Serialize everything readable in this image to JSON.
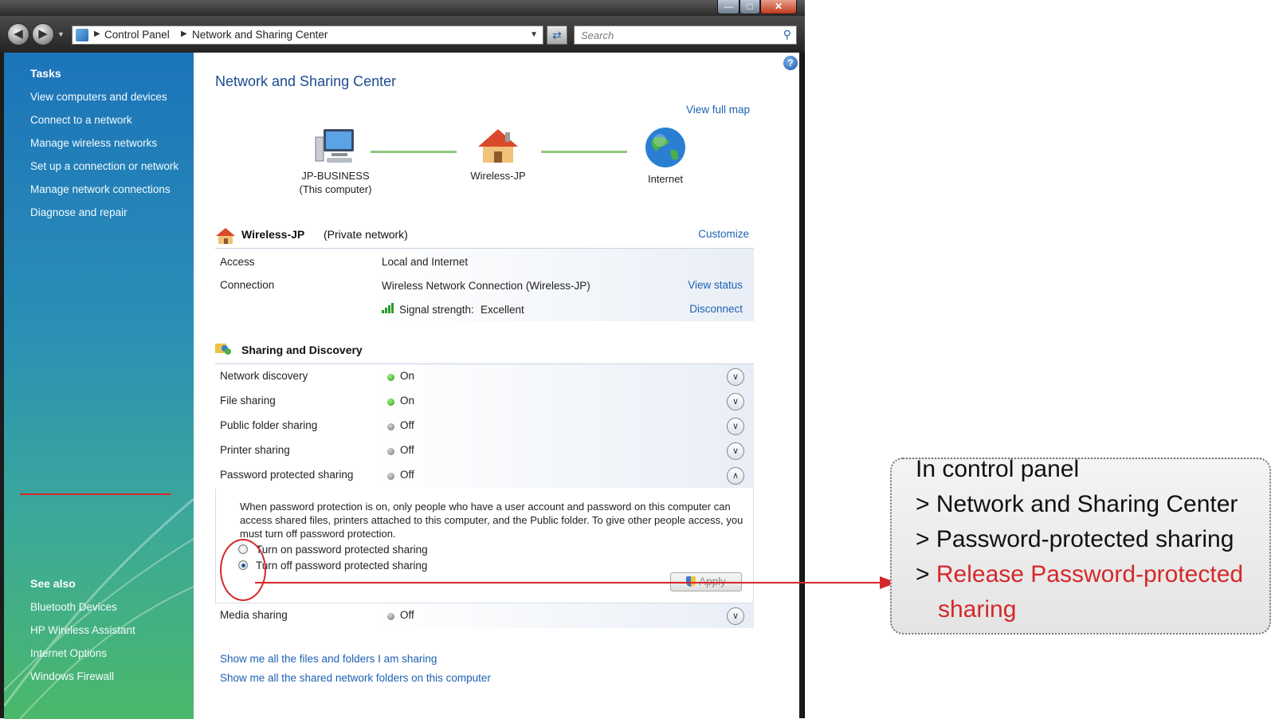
{
  "window": {
    "controls": {
      "minimize": "—",
      "maximize": "□",
      "close": "✕"
    }
  },
  "address_bar": {
    "breadcrumbs": [
      "Control Panel",
      "Network and Sharing Center"
    ],
    "search_placeholder": "Search"
  },
  "sidebar": {
    "tasks_heading": "Tasks",
    "tasks": [
      "View computers and devices",
      "Connect to a network",
      "Manage wireless networks",
      "Set up a connection or network",
      "Manage network connections",
      "Diagnose and repair"
    ],
    "see_also_heading": "See also",
    "see_also": [
      "Bluetooth Devices",
      "HP Wireless Assistant",
      "Internet Options",
      "Windows Firewall"
    ]
  },
  "main": {
    "title": "Network and Sharing Center",
    "view_full_map": "View full map",
    "map": {
      "computer_name": "JP-BUSINESS",
      "computer_sub": "(This computer)",
      "network_name": "Wireless-JP",
      "internet_label": "Internet"
    },
    "network": {
      "name": "Wireless-JP",
      "type": "(Private network)",
      "customize": "Customize",
      "access_label": "Access",
      "access_value": "Local and Internet",
      "connection_label": "Connection",
      "connection_value": "Wireless Network Connection (Wireless-JP)",
      "view_status": "View status",
      "signal_label": "Signal strength:",
      "signal_value": "Excellent",
      "disconnect": "Disconnect"
    },
    "sharing": {
      "title": "Sharing and Discovery",
      "rows": [
        {
          "label": "Network discovery",
          "status": "On"
        },
        {
          "label": "File sharing",
          "status": "On"
        },
        {
          "label": "Public folder sharing",
          "status": "Off"
        },
        {
          "label": "Printer sharing",
          "status": "Off"
        },
        {
          "label": "Password protected sharing",
          "status": "Off"
        },
        {
          "label": "Media sharing",
          "status": "Off"
        }
      ],
      "password_description": "When password protection is on, only people who have a user account and password on this computer can access shared files, printers attached to this computer, and the Public folder. To give other people access, you must turn off password protection.",
      "radio_on": "Turn on password protected sharing",
      "radio_off": "Turn off password protected sharing",
      "apply": "Apply"
    },
    "links": [
      "Show me all the files and folders I am sharing",
      "Show me all the shared network folders on this computer"
    ]
  },
  "annotation": {
    "line1": "In control panel",
    "line2": "> Network and Sharing Center",
    "line3": "> Password-protected sharing",
    "line4_prefix": ">",
    "line4_red": "Release Password-protected",
    "line5_red": "sharing"
  },
  "colors": {
    "link": "#1c61b3",
    "title": "#1c4c8f",
    "annotation_red": "#d5282a",
    "status_on": "#1f9a1f",
    "status_off": "#6f6f6f"
  },
  "icons": {
    "computer": "computer-icon",
    "house": "house-icon",
    "globe": "globe-icon",
    "sharing": "sharing-icon",
    "signal": "signal-strength-icon",
    "shield": "uac-shield-icon"
  }
}
